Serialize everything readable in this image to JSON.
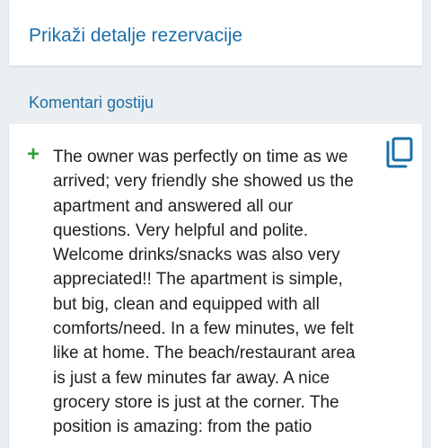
{
  "reservation": {
    "details_link": "Prikaži detalje rezervacije"
  },
  "comments": {
    "section_title": "Komentari gostiju",
    "expand_symbol": "+",
    "copy_icon": "copy-icon",
    "text": "The owner was perfectly on time as we arrived; very friendly she showed us the apartment and answered all our questions. Very helpful and polite. Welcome drinks/snacks was also very appreciated!! The apartment is simple, but big, clean and equipped with all comforts/need. In a few minutes, we felt like at home. The beach/restaurant area is just a few minutes far away. A nice grocery store is just at the corner. The position is amazing: from the patio"
  },
  "colors": {
    "link_blue": "#1a6fa8",
    "expand_green": "#2e9e3e",
    "background": "#eceff1"
  }
}
